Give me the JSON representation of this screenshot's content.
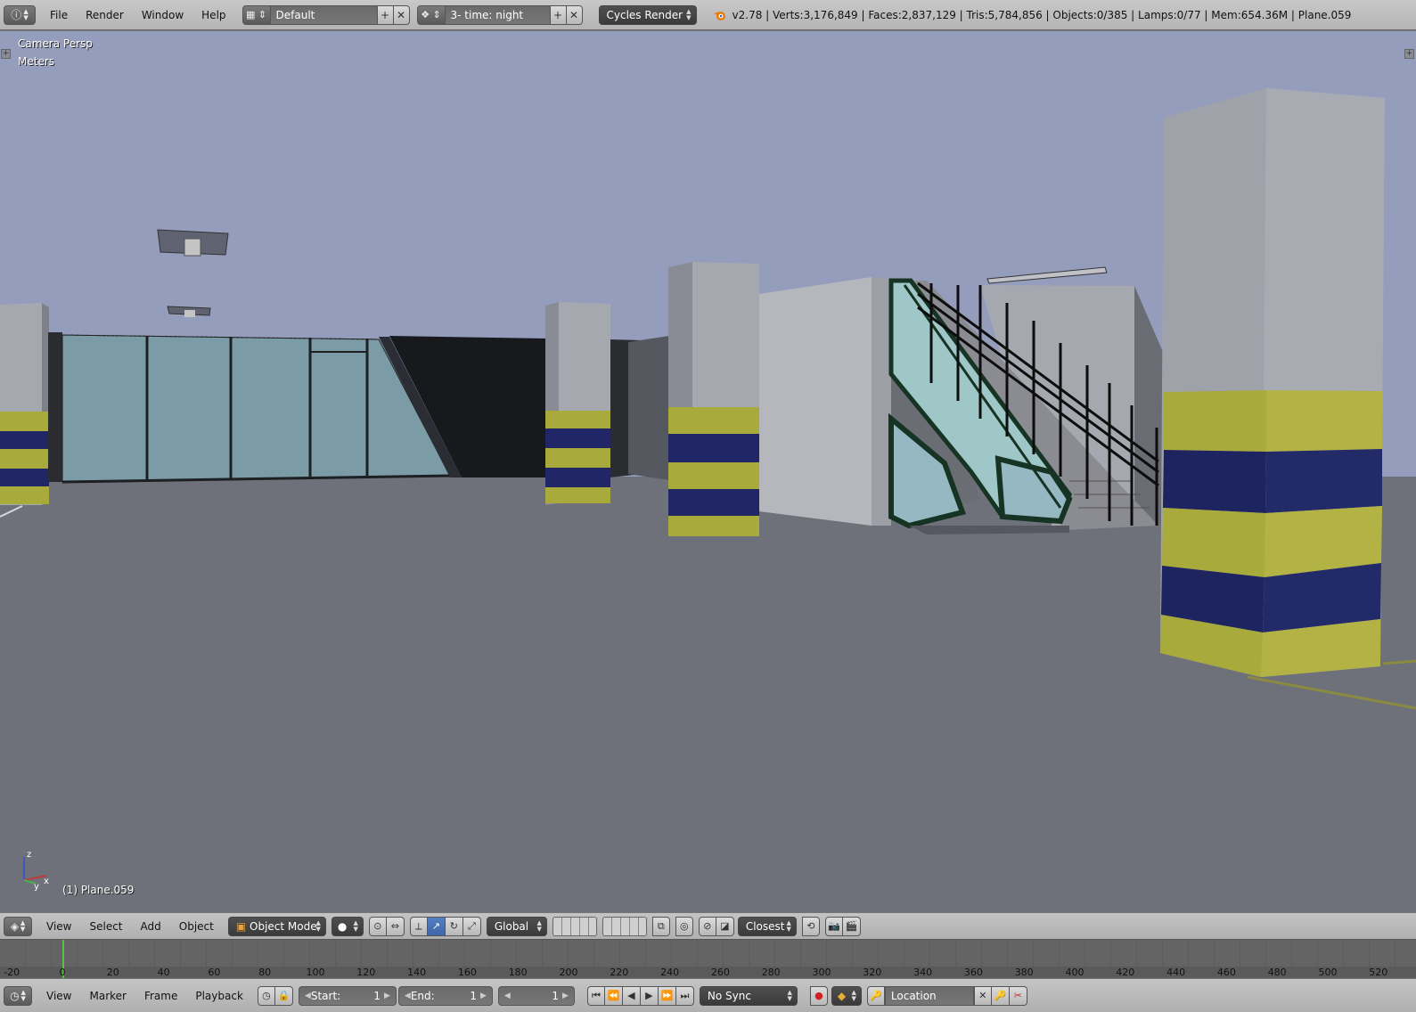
{
  "top_bar": {
    "menus": [
      "File",
      "Render",
      "Window",
      "Help"
    ],
    "screen_layout": "Default",
    "scene": "3- time: night",
    "render_engine": "Cycles Render",
    "stats": "v2.78 | Verts:3,176,849 | Faces:2,837,129 | Tris:5,784,856 | Objects:0/385 | Lamps:0/77 | Mem:654.36M | Plane.059"
  },
  "viewport": {
    "view_label": "Camera Persp",
    "units_label": "Meters",
    "active_object_label": "(1) Plane.059",
    "axis_labels": {
      "z": "z",
      "x": "x",
      "y": "y"
    },
    "colors": {
      "sky": "#9aa3c2",
      "floor": "#6e717a",
      "pillar_grey": "#a4a6ae",
      "stripe_yellow": "#a9aa3c",
      "stripe_blue": "#1e2460",
      "glass": "#7a9aa5"
    }
  },
  "view3d_header": {
    "menus": [
      "View",
      "Select",
      "Add",
      "Object"
    ],
    "mode": "Object Mode",
    "transform_orientation": "Global",
    "snap_target": "Closest"
  },
  "timeline": {
    "ticks": [
      "-20",
      "0",
      "20",
      "40",
      "60",
      "80",
      "100",
      "120",
      "140",
      "160",
      "180",
      "200",
      "220",
      "240",
      "260",
      "280",
      "300",
      "320",
      "340",
      "360",
      "380",
      "400",
      "420",
      "440",
      "460",
      "480",
      "500",
      "520"
    ],
    "current_frame_marker": 0
  },
  "timeline_header": {
    "menus": [
      "View",
      "Marker",
      "Frame",
      "Playback"
    ],
    "start_label": "Start:",
    "start_value": "1",
    "end_label": "End:",
    "end_value": "1",
    "current_frame": "1",
    "sync": "No Sync",
    "keying_set": "Location"
  }
}
